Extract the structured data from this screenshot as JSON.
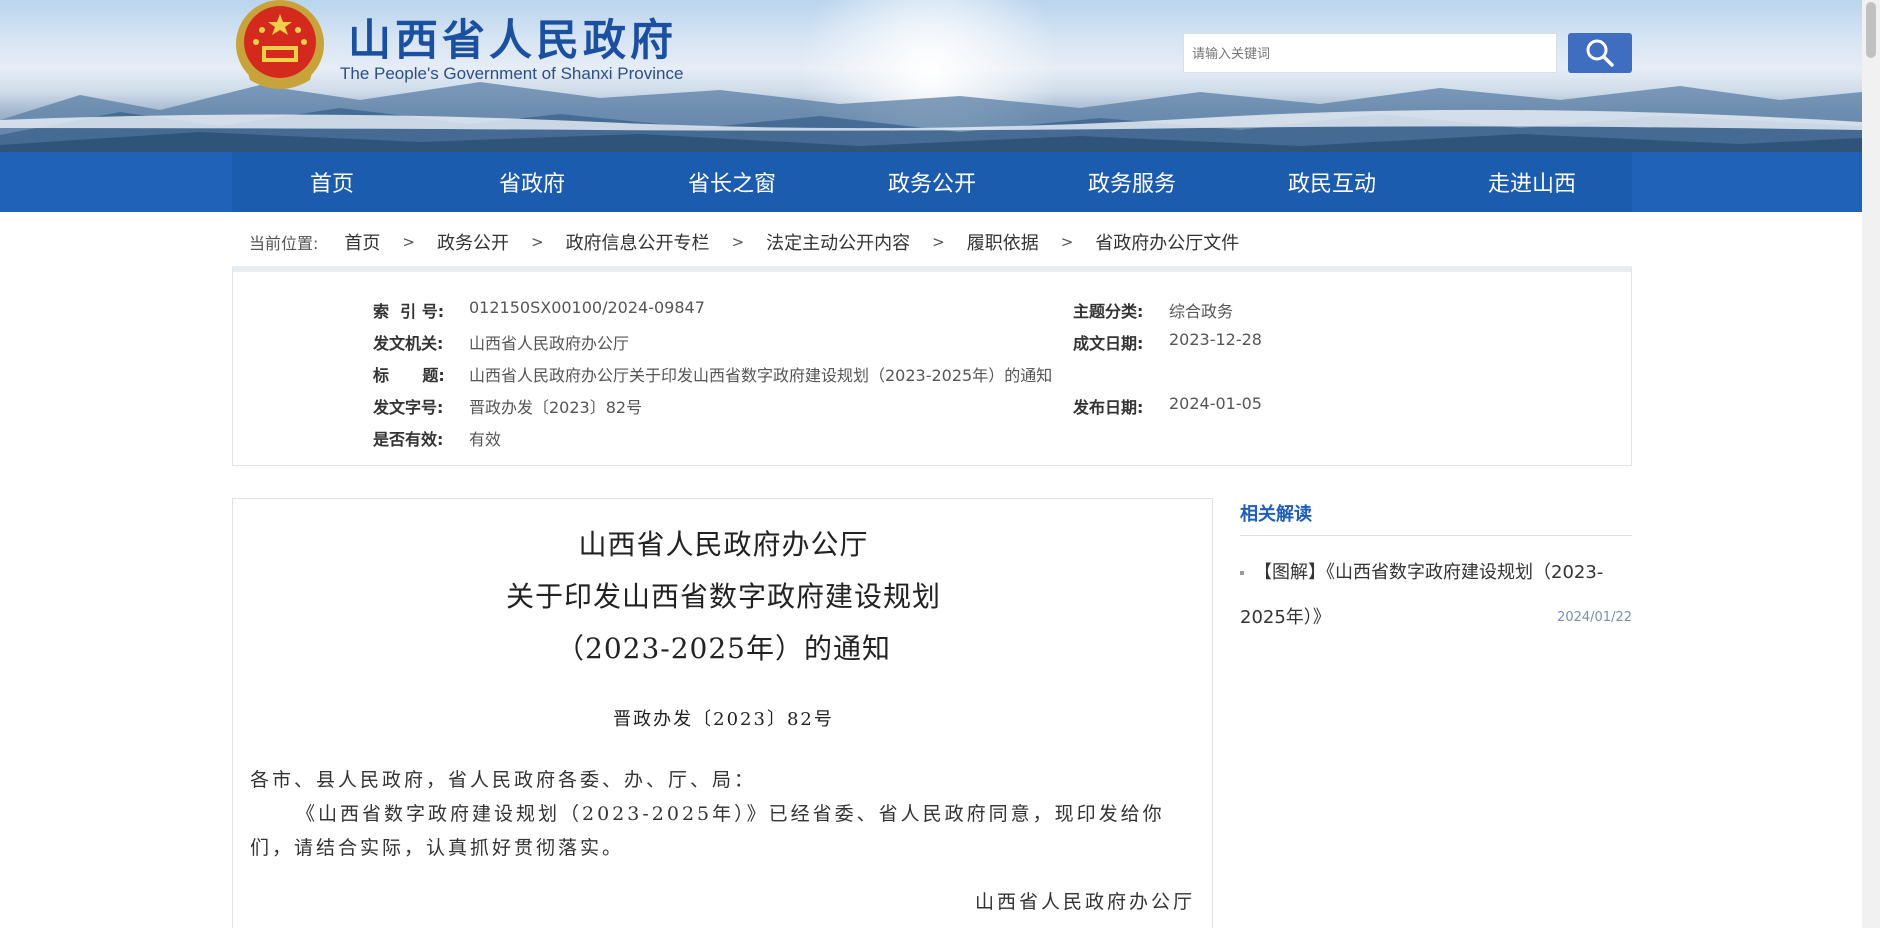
{
  "header": {
    "title": "山西省人民政府",
    "subtitle": "The People's Government of Shanxi Province",
    "search_placeholder": "请输入关键词",
    "emblem_icon": "national-emblem-icon",
    "search_icon": "search-icon"
  },
  "nav": {
    "items": [
      "首页",
      "省政府",
      "省长之窗",
      "政务公开",
      "政务服务",
      "政民互动",
      "走进山西"
    ]
  },
  "breadcrumb": {
    "label": "当前位置:",
    "items": [
      "首页",
      "政务公开",
      "政府信息公开专栏",
      "法定主动公开内容",
      "履职依据",
      "省政府办公厅文件"
    ],
    "separator": ">"
  },
  "meta": {
    "index_label": "索  引 号:",
    "index_value": "012150SX00100/2024-09847",
    "topic_label": "主题分类:",
    "topic_value": "综合政务",
    "issuer_label": "发文机关:",
    "issuer_value": "山西省人民政府办公厅",
    "created_label": "成文日期:",
    "created_value": "2023-12-28",
    "title_label": "标      题:",
    "title_value": "山西省人民政府办公厅关于印发山西省数字政府建设规划（2023-2025年）的通知",
    "docno_label": "发文字号:",
    "docno_value": "晋政办发〔2023〕82号",
    "published_label": "发布日期:",
    "published_value": "2024-01-05",
    "valid_label": "是否有效:",
    "valid_value": "有效"
  },
  "article": {
    "title_line1": "山西省人民政府办公厅",
    "title_line2": "关于印发山西省数字政府建设规划",
    "title_line3": "（2023-2025年）的通知",
    "doc_number": "晋政办发〔2023〕82号",
    "salutation": "各市、县人民政府，省人民政府各委、办、厅、局：",
    "body": "《山西省数字政府建设规划（2023-2025年）》已经省委、省人民政府同意，现印发给你们，请结合实际，认真抓好贯彻落实。",
    "signature": "山西省人民政府办公厅"
  },
  "sidebar": {
    "title": "相关解读",
    "items": [
      {
        "text": "【图解】《山西省数字政府建设规划（2023-2025年）》",
        "date": "2024/01/22"
      }
    ]
  },
  "colors": {
    "brand_blue": "#1f62b8",
    "title_blue": "#1b4fa0",
    "search_button": "#3f6dc0"
  }
}
